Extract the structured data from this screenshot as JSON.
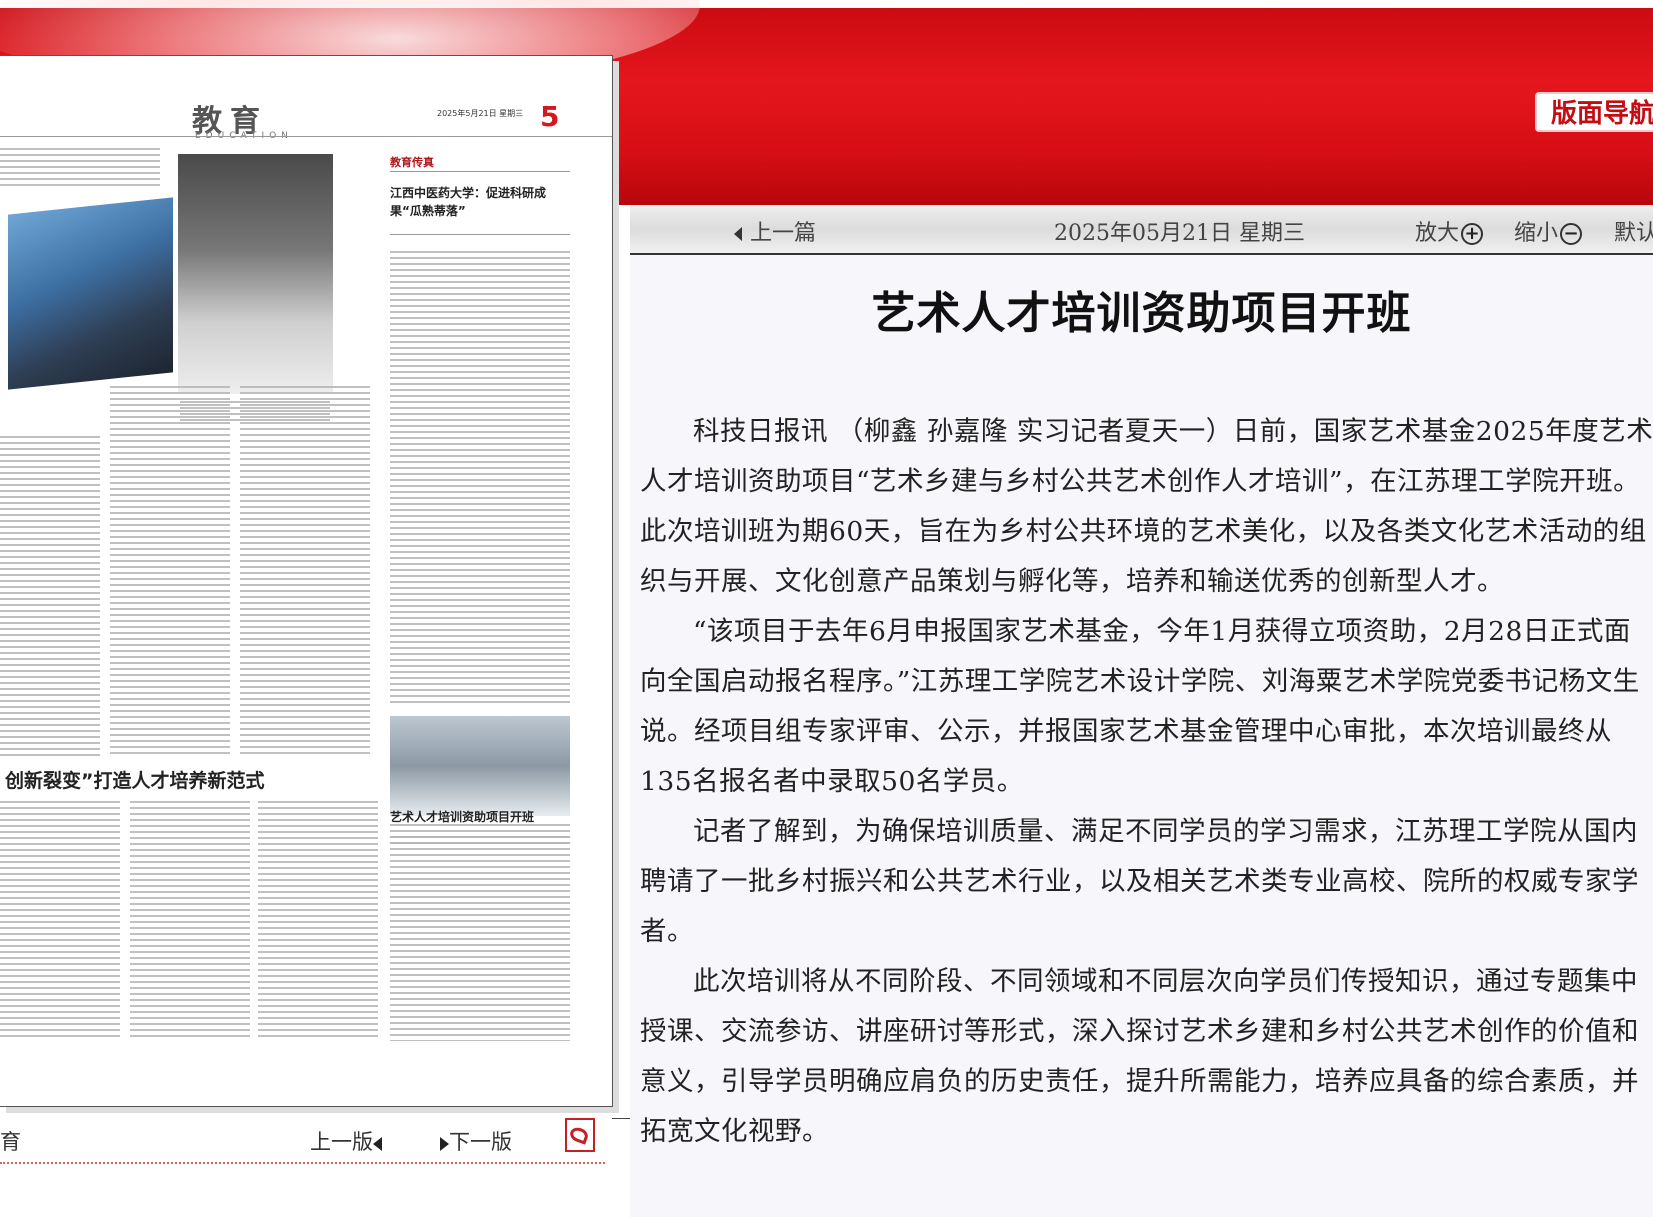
{
  "banner": {
    "nav_label": "版面导航"
  },
  "toolbar": {
    "prev_article": "上一篇",
    "date": "2025年05月21日  星期三",
    "zoom_in": "放大",
    "zoom_out": "缩小",
    "default": "默认"
  },
  "newspaper_page": {
    "section_title": "教育",
    "section_subtitle": "EDUCATION",
    "date_line": "2025年5月21日 星期三",
    "page_number": "5",
    "column_label": "教育传真",
    "column_headline": "江西中医药大学：促进科研成果“瓜熟蒂落”",
    "main_headline": "创新裂变”打造人才培养新范式",
    "small_headline": "艺术人才培训资助项目开班"
  },
  "page_nav": {
    "left_label": "育",
    "prev_page": "上一版",
    "next_page": "下一版"
  },
  "article": {
    "title": "艺术人才培训资助项目开班",
    "paragraphs": [
      "科技日报讯  （柳鑫  孙嘉隆  实习记者夏天一）日前，国家艺术基金2025年度艺术人才培训资助项目“艺术乡建与乡村公共艺术创作人才培训”，在江苏理工学院开班。此次培训班为期60天，旨在为乡村公共环境的艺术美化，以及各类文化艺术活动的组织与开展、文化创意产品策划与孵化等，培养和输送优秀的创新型人才。",
      "“该项目于去年6月申报国家艺术基金，今年1月获得立项资助，2月28日正式面向全国启动报名程序。”江苏理工学院艺术设计学院、刘海粟艺术学院党委书记杨文生说。经项目组专家评审、公示，并报国家艺术基金管理中心审批，本次培训最终从135名报名者中录取50名学员。",
      "记者了解到，为确保培训质量、满足不同学员的学习需求，江苏理工学院从国内聘请了一批乡村振兴和公共艺术行业，以及相关艺术类专业高校、院所的权威专家学者。",
      "此次培训将从不同阶段、不同领域和不同层次向学员们传授知识，通过专题集中授课、交流参访、讲座研讨等形式，深入探讨艺术乡建和乡村公共艺术创作的价值和意义，引导学员明确应肩负的历史责任，提升所需能力，培养应具备的综合素质，并拓宽文化视野。"
    ]
  }
}
